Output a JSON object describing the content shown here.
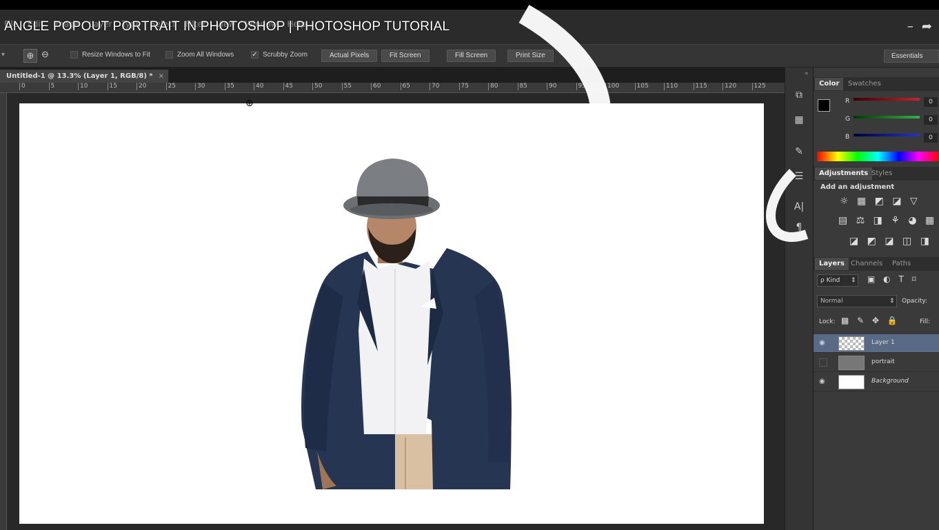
{
  "video": {
    "title": "ANGLE POPOUT PORTRAIT IN PHOTOSHOP | PHOTOSHOP TUTORIAL",
    "controls": [
      "–",
      "➦"
    ]
  },
  "menu": [
    "File",
    "Edit",
    "Image",
    "Layer",
    "Type",
    "Select",
    "Filter",
    "View",
    "Window",
    "Help"
  ],
  "options": {
    "resize_windows": "Resize Windows to Fit",
    "zoom_all": "Zoom All Windows",
    "scrubby_zoom": "Scrubby Zoom",
    "actual_pixels": "Actual Pixels",
    "fit_screen": "Fit Screen",
    "fill_screen": "Fill Screen",
    "print_size": "Print Size",
    "workspace": "Essentials"
  },
  "document": {
    "tab_title": "Untitled-1 @ 13.3% (Layer 1, RGB/8) *",
    "close": "×"
  },
  "ruler": {
    "ticks": [
      "0",
      "5",
      "10",
      "15",
      "20",
      "25",
      "30",
      "35",
      "40",
      "45",
      "50",
      "55",
      "60",
      "65",
      "70",
      "75",
      "80",
      "85",
      "90",
      "95",
      "100",
      "105",
      "110",
      "115",
      "120",
      "125"
    ]
  },
  "color_panel": {
    "tabs": [
      "Color",
      "Swatches"
    ],
    "r_label": "R",
    "g_label": "G",
    "b_label": "B",
    "r_value": "0",
    "g_value": "0",
    "b_value": "0",
    "r_color": "#c8232c",
    "g_color": "#35b04a",
    "b_color": "#2434c8"
  },
  "adjustments_panel": {
    "tabs": [
      "Adjustments",
      "Styles"
    ],
    "heading": "Add an adjustment",
    "row1": "☼ ▦ ◩ ◪ ▽",
    "row2": "▤ ⚖ ◨ ⚘ ◕ ▦",
    "row3": "◪ ◩ ◪ ◫ ◨"
  },
  "layers_panel": {
    "tabs": [
      "Layers",
      "Channels",
      "Paths"
    ],
    "kind_filter": "ρ Kind",
    "blend_mode": "Normal",
    "opacity_label": "Opacity:",
    "lock_label": "Lock:",
    "fill_label": "Fill:",
    "layers": [
      {
        "name": "Layer 1",
        "visible": true,
        "selected": true
      },
      {
        "name": "portrait",
        "visible": false,
        "selected": false
      },
      {
        "name": "Background",
        "visible": true,
        "selected": false
      }
    ]
  }
}
